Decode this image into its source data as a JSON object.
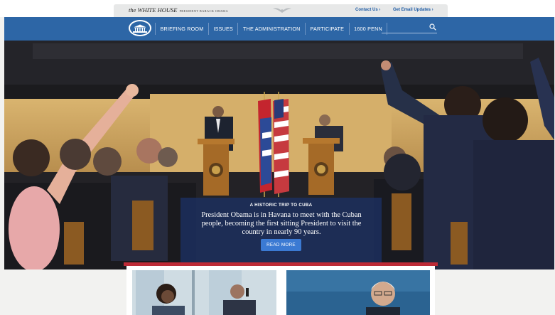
{
  "header": {
    "site_name": "the WHITE HOUSE",
    "site_subtitle": "PRESIDENT BARACK OBAMA",
    "contact_link": "Contact Us ›",
    "email_link": "Get Email Updates ›"
  },
  "nav": {
    "items": [
      "BRIEFING ROOM",
      "ISSUES",
      "THE ADMINISTRATION",
      "PARTICIPATE",
      "1600 PENN"
    ],
    "search_placeholder": ""
  },
  "hero": {
    "kicker": "A HISTORIC TRIP TO CUBA",
    "headline": "President Obama is in Havana to meet with the Cuban people, becoming the first sitting President to visit the country in nearly 90 years.",
    "button": "READ MORE"
  },
  "colors": {
    "nav_blue": "#2d66a6",
    "accent_red": "#bd2a36",
    "caption_blue": "#1c3060",
    "button_blue": "#3b7ad3"
  },
  "icons": [
    "white-house-seal-icon",
    "eagle-icon",
    "search-icon"
  ]
}
